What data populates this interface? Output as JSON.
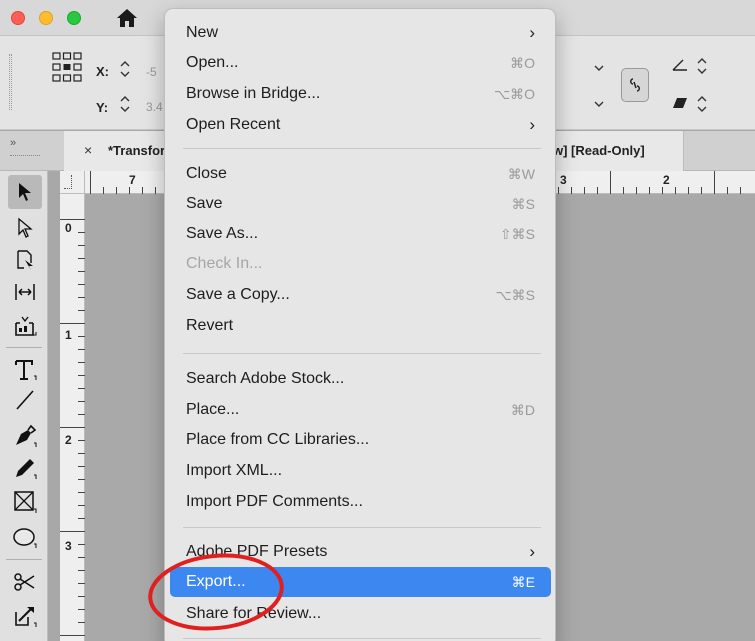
{
  "control_bar": {
    "x_label": "X:",
    "y_label": "Y:",
    "x_value": "-5",
    "y_value": "3.4"
  },
  "tabs": [
    {
      "close": "×",
      "label": "*Transformations"
    },
    {
      "label": "w] [Read-Only]"
    }
  ],
  "panel_collapse": "»",
  "rulers": {
    "horizontal": [
      "7",
      "3",
      "2"
    ],
    "vertical": [
      "0",
      "1",
      "2",
      "3"
    ]
  },
  "menu": {
    "items": [
      {
        "label": "New",
        "shortcut": "",
        "submenu": true,
        "disabled": false
      },
      {
        "label": "Open...",
        "shortcut": "⌘O",
        "submenu": false,
        "disabled": false
      },
      {
        "label": "Browse in Bridge...",
        "shortcut": "⌥⌘O",
        "submenu": false,
        "disabled": false
      },
      {
        "label": "Open Recent",
        "shortcut": "",
        "submenu": true,
        "disabled": false
      },
      {
        "label": "Close",
        "shortcut": "⌘W",
        "submenu": false,
        "disabled": false
      },
      {
        "label": "Save",
        "shortcut": "⌘S",
        "submenu": false,
        "disabled": false
      },
      {
        "label": "Save As...",
        "shortcut": "⇧⌘S",
        "submenu": false,
        "disabled": false
      },
      {
        "label": "Check In...",
        "shortcut": "",
        "submenu": false,
        "disabled": true
      },
      {
        "label": "Save a Copy...",
        "shortcut": "⌥⌘S",
        "submenu": false,
        "disabled": false
      },
      {
        "label": "Revert",
        "shortcut": "",
        "submenu": false,
        "disabled": false
      },
      {
        "label": "Search Adobe Stock...",
        "shortcut": "",
        "submenu": false,
        "disabled": false
      },
      {
        "label": "Place...",
        "shortcut": "⌘D",
        "submenu": false,
        "disabled": false
      },
      {
        "label": "Place from CC Libraries...",
        "shortcut": "",
        "submenu": false,
        "disabled": false
      },
      {
        "label": "Import XML...",
        "shortcut": "",
        "submenu": false,
        "disabled": false
      },
      {
        "label": "Import PDF Comments...",
        "shortcut": "",
        "submenu": false,
        "disabled": false
      },
      {
        "label": "Adobe PDF Presets",
        "shortcut": "",
        "submenu": true,
        "disabled": false
      },
      {
        "label": "Export...",
        "shortcut": "⌘E",
        "submenu": false,
        "disabled": false,
        "highlighted": true
      },
      {
        "label": "Share for Review...",
        "shortcut": "",
        "submenu": false,
        "disabled": false
      }
    ],
    "submenu_arrow": "›"
  },
  "colors": {
    "highlight": "#3d88f0",
    "annotation": "#e02020",
    "menu_bg": "#e6e6e6"
  }
}
